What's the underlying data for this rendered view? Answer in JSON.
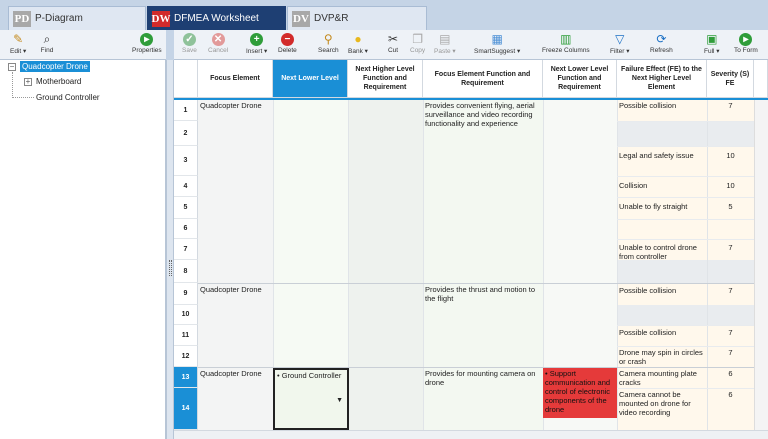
{
  "tabs": [
    {
      "badge": "PD",
      "label": "P-Diagram"
    },
    {
      "badge": "DW",
      "label": "DFMEA Worksheet"
    },
    {
      "badge": "DV",
      "label": "DVP&R"
    }
  ],
  "left_toolbar": {
    "edit": "Edit ▾",
    "find": "Find",
    "properties": "Properties"
  },
  "toolbar": {
    "save": "Save",
    "cancel": "Cancel",
    "insert": "Insert ▾",
    "delete": "Delete",
    "search": "Search",
    "bank": "Bank ▾",
    "cut": "Cut",
    "copy": "Copy",
    "paste": "Paste ▾",
    "smartsuggest": "SmartSuggest ▾",
    "freeze": "Freeze Columns",
    "filter": "Filter ▾",
    "refresh": "Refresh",
    "full": "Full ▾",
    "toform": "To Form"
  },
  "tree": {
    "root": "Quadcopter Drone",
    "children": [
      "Motherboard",
      "Ground Controller"
    ]
  },
  "columns": {
    "focus": "Focus Element",
    "nll": "Next Lower Level",
    "nhl": "Next Higher Level Function and Requirement",
    "fef": "Focus Element Function and Requirement",
    "nlf": "Next Lower Level Function and Requirement",
    "fe": "Failure Effect (FE) to the Next Higher Level Element",
    "sev": "Severity (S) FE"
  },
  "rows": [
    "1",
    "2",
    "3",
    "4",
    "5",
    "6",
    "7",
    "8",
    "9",
    "10",
    "11",
    "12",
    "13",
    "14"
  ],
  "cells": {
    "focus1": "Quadcopter Drone",
    "focus2": "Quadcopter Drone",
    "focus3": "Quadcopter Drone",
    "fef1": "Provides convenient flying, aerial surveillance and video recording functionality and experience",
    "fef2": "Provides the thrust and motion to the flight",
    "fef3": "Provides for mounting camera on drone",
    "nll_edit": "• Ground Controller",
    "nlf_red": "• Support communication and control of electronic components of the drone",
    "fe": [
      "Possible collision",
      "Legal and safety issue",
      "Collision",
      "Unable to fly straight",
      "Unable to control drone from controller",
      "Possible collision",
      "Possible collision",
      "Drone may spin in circles or crash",
      "Camera mounting plate cracks",
      "Camera cannot be mounted on drone for video recording"
    ],
    "sev": [
      "7",
      "10",
      "10",
      "5",
      "7",
      "7",
      "7",
      "7",
      "6",
      "6"
    ]
  }
}
